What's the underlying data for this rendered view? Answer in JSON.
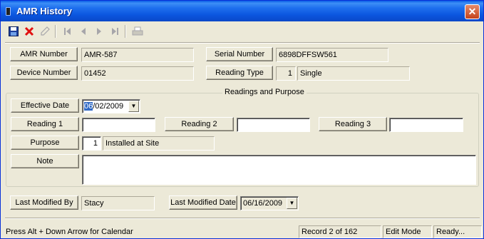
{
  "window": {
    "title": "AMR History",
    "close": "✕"
  },
  "toolbar": {
    "save": "💾",
    "delete": "✕",
    "edit": "✎",
    "first": "⏮",
    "prev": "◀",
    "next": "▶",
    "last": "⏭",
    "print": "🖨",
    "icons": [
      "floppy-disk-icon",
      "red-x-icon",
      "pencil-icon",
      "first-record-icon",
      "previous-record-icon",
      "next-record-icon",
      "last-record-icon",
      "printer-icon"
    ]
  },
  "amr": {
    "amr_number_label": "AMR Number",
    "amr_number": "AMR-587",
    "serial_number_label": "Serial Number",
    "serial_number": "6898DFFSW561",
    "device_number_label": "Device Number",
    "device_number": "01452",
    "reading_type_label": "Reading Type",
    "reading_type_code": "1",
    "reading_type": "Single"
  },
  "readings": {
    "group_title": "Readings and Purpose",
    "effective_date_label": "Effective Date",
    "effective_date_sel": "06",
    "effective_date_rest": "/02/2009",
    "reading1_label": "Reading 1",
    "reading1": "",
    "reading2_label": "Reading 2",
    "reading2": "",
    "reading3_label": "Reading 3",
    "reading3": "",
    "purpose_label": "Purpose",
    "purpose_code": "1",
    "purpose": "Installed at Site",
    "note_label": "Note",
    "note": ""
  },
  "modified": {
    "by_label": "Last Modified By",
    "by": "Stacy",
    "date_label": "Last Modified Date",
    "date": "06/16/2009"
  },
  "status": {
    "hint": "Press Alt + Down Arrow for Calendar",
    "record": "Record 2 of 162",
    "mode": "Edit Mode",
    "state": "Ready..."
  }
}
